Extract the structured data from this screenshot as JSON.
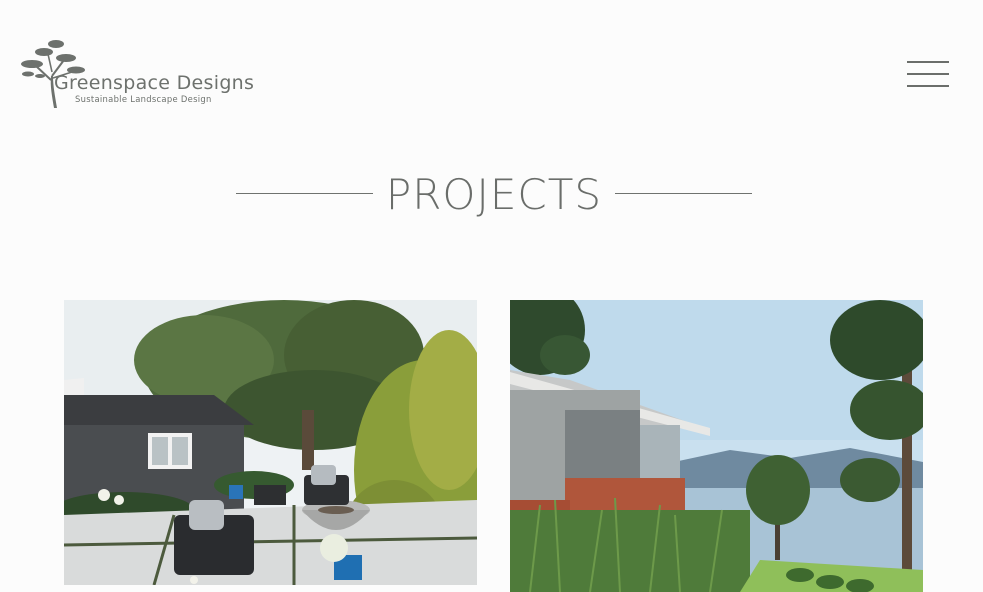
{
  "header": {
    "logo": {
      "name": "Greenspace Designs",
      "tagline": "Sustainable Landscape Design",
      "icon": "tree-icon"
    },
    "menu_icon": "hamburger-menu-icon"
  },
  "main": {
    "title": "PROJECTS",
    "projects": [
      {
        "image": "garden-patio-photo"
      },
      {
        "image": "waterfront-house-photo"
      }
    ]
  },
  "colors": {
    "background": "#fcfcfc",
    "text": "#6f726f",
    "logo": "#6d716d"
  }
}
